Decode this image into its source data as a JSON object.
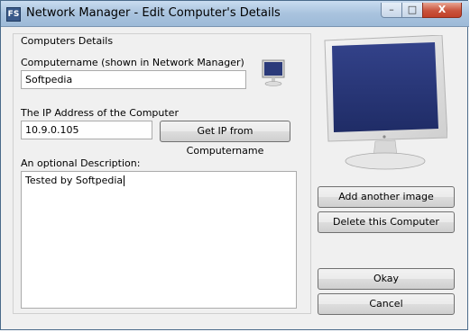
{
  "window": {
    "app_icon": "FS",
    "title": "Network Manager - Edit Computer's Details",
    "buttons": {
      "minimize": "–",
      "maximize": "□",
      "close": "X"
    }
  },
  "form": {
    "group_title": "Computers Details",
    "name_label": "Computername (shown in Network Manager)",
    "name_value": "Softpedia",
    "ip_label": "The IP Address of the Computer",
    "ip_value": "10.9.0.105",
    "get_ip_button": "Get IP from Computername",
    "desc_label": "An optional Description:",
    "desc_value": "Tested by Softpedia"
  },
  "side": {
    "add_image_button": "Add another image",
    "delete_button": "Delete this Computer",
    "okay_button": "Okay",
    "cancel_button": "Cancel"
  },
  "icons": {
    "small": "monitor-icon",
    "large": "monitor-image"
  },
  "colors": {
    "screen": "#2b3a7a",
    "titlebar": "#a9c3de",
    "close": "#c24028"
  }
}
